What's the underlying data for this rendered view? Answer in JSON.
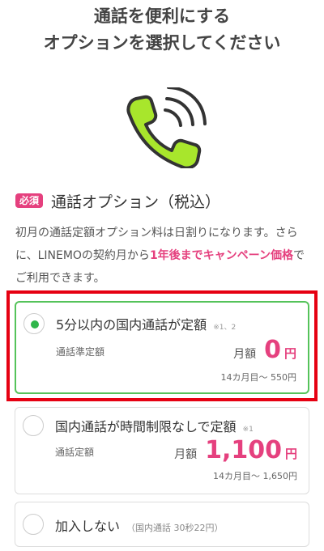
{
  "header": {
    "title_line1": "通話を便利にする",
    "title_line2": "オプションを選択してください"
  },
  "icon": {
    "name": "phone-icon",
    "fill": "#a8e62c",
    "stroke": "#333333"
  },
  "section": {
    "badge": "必須",
    "title": "通話オプション（税込）",
    "desc_part1": "初月の通話定額オプション料は日割りになります。さらに、LINEMOの契約月から",
    "desc_highlight": "1年後までキャンペーン価格",
    "desc_part2": "でご利用できます。"
  },
  "options": [
    {
      "name": "5分以内の国内通話が定額",
      "note": "※1、2",
      "sub": "通話準定額",
      "price_label": "月額",
      "price": "0",
      "unit": "円",
      "after": "14カ月目〜 550円",
      "selected": true
    },
    {
      "name": "国内通話が時間制限なしで定額",
      "note": "※1",
      "sub": "通話定額",
      "price_label": "月額",
      "price": "1,100",
      "unit": "円",
      "after": "14カ月目〜 1,650円",
      "selected": false
    },
    {
      "name": "加入しない",
      "note": "（国内通話 30秒22円）",
      "selected": false
    }
  ],
  "colors": {
    "accent": "#e5407e",
    "selected_border": "#55c35a",
    "highlight_frame": "#e60012"
  }
}
